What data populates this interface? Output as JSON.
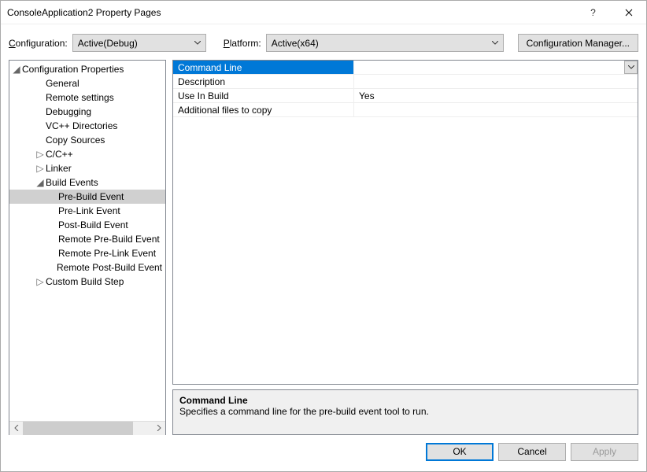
{
  "title": "ConsoleApplication2 Property Pages",
  "toolbar": {
    "configuration_label": "Configuration:",
    "configuration_value": "Active(Debug)",
    "platform_label": "Platform:",
    "platform_value": "Active(x64)",
    "config_manager": "Configuration Manager..."
  },
  "tree": {
    "root": "Configuration Properties",
    "items": [
      {
        "label": "General",
        "indent": 2
      },
      {
        "label": "Remote settings",
        "indent": 2
      },
      {
        "label": "Debugging",
        "indent": 2
      },
      {
        "label": "VC++ Directories",
        "indent": 2
      },
      {
        "label": "Copy Sources",
        "indent": 2
      },
      {
        "label": "C/C++",
        "indent": 2,
        "expander": "▷"
      },
      {
        "label": "Linker",
        "indent": 2,
        "expander": "▷"
      },
      {
        "label": "Build Events",
        "indent": 2,
        "expander": "◢"
      },
      {
        "label": "Pre-Build Event",
        "indent": 3,
        "selected": true
      },
      {
        "label": "Pre-Link Event",
        "indent": 3
      },
      {
        "label": "Post-Build Event",
        "indent": 3
      },
      {
        "label": "Remote Pre-Build Event",
        "indent": 3
      },
      {
        "label": "Remote Pre-Link Event",
        "indent": 3
      },
      {
        "label": "Remote Post-Build Event",
        "indent": 3
      },
      {
        "label": "Custom Build Step",
        "indent": 2,
        "expander": "▷"
      }
    ]
  },
  "grid": [
    {
      "name": "Command Line",
      "value": "",
      "selected": true,
      "dropdown": true
    },
    {
      "name": "Description",
      "value": ""
    },
    {
      "name": "Use In Build",
      "value": "Yes"
    },
    {
      "name": "Additional files to copy",
      "value": ""
    }
  ],
  "description": {
    "title": "Command Line",
    "body": "Specifies a command line for the pre-build event tool to run."
  },
  "footer": {
    "ok": "OK",
    "cancel": "Cancel",
    "apply": "Apply"
  }
}
